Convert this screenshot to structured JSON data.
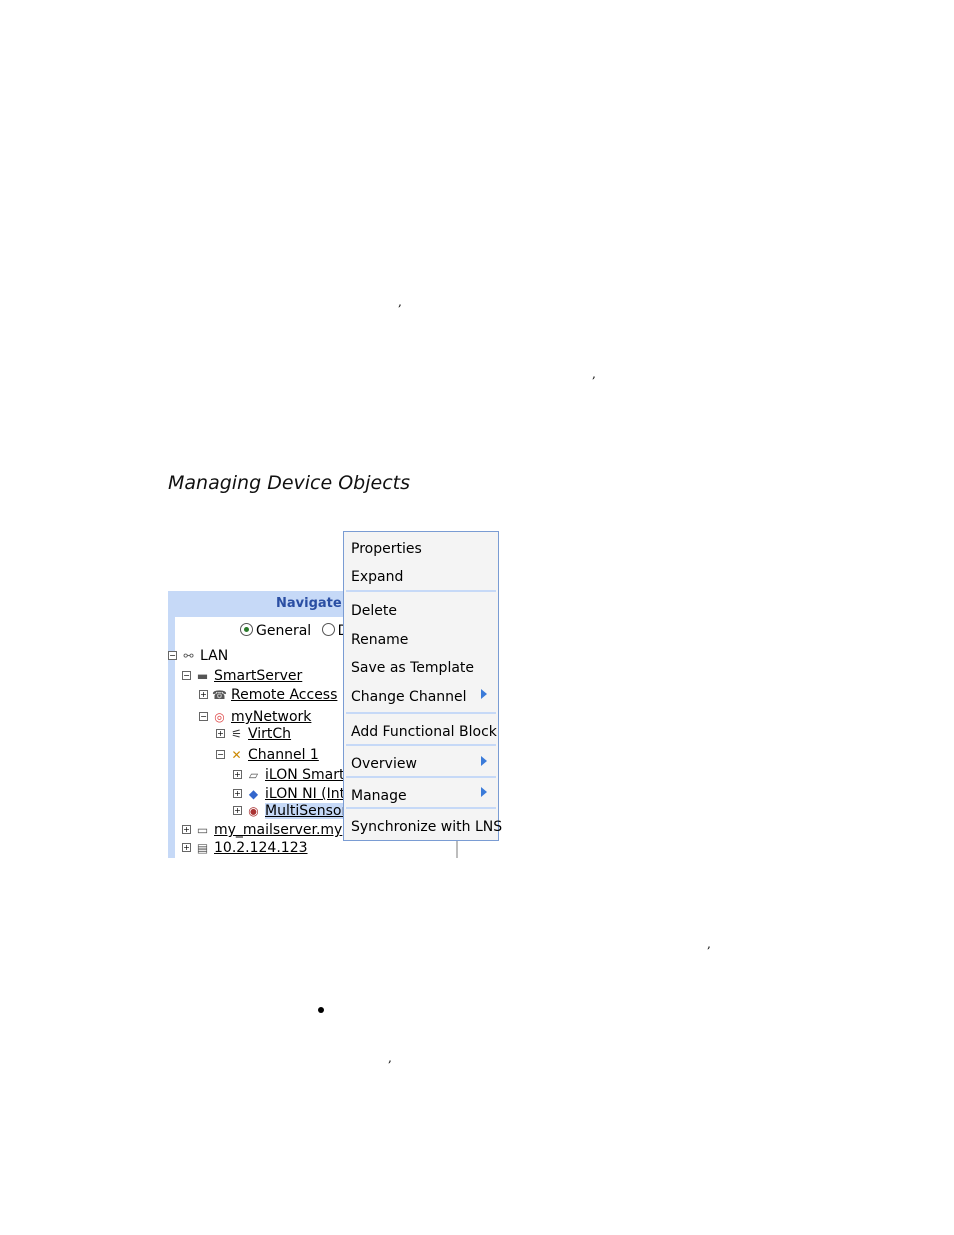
{
  "document": {
    "marks": [
      ",",
      ",",
      ",",
      ","
    ],
    "heading": "Managing Device Objects"
  },
  "tree_panel": {
    "title": "Navigate",
    "radios": [
      {
        "label": "General",
        "selected": true
      },
      {
        "label": "D",
        "selected": false
      }
    ],
    "nodes": [
      {
        "label": "LAN",
        "toggle": "−",
        "icon": "lan-icon"
      },
      {
        "label": "SmartServer",
        "toggle": "−",
        "icon": "server-icon"
      },
      {
        "label": "Remote Access",
        "toggle": "+",
        "icon": "phone-icon"
      },
      {
        "label": "myNetwork",
        "toggle": "−",
        "icon": "network-icon"
      },
      {
        "label": "VirtCh",
        "toggle": "+",
        "icon": "virtual-channel-icon"
      },
      {
        "label": "Channel 1",
        "toggle": "−",
        "icon": "channel-icon"
      },
      {
        "label": "iLON Smart",
        "toggle": "+",
        "icon": "ilon-device-icon"
      },
      {
        "label": "iLON NI (Int",
        "toggle": "+",
        "icon": "network-interface-icon"
      },
      {
        "label": "MultiSensor",
        "toggle": "+",
        "icon": "sensor-icon"
      },
      {
        "label": "my_mailserver.my",
        "toggle": "+",
        "icon": "computer-icon"
      },
      {
        "label": "10.2.124.123",
        "toggle": "+",
        "icon": "server-icon"
      }
    ]
  },
  "context_menu": {
    "items": [
      {
        "label": "Properties",
        "submenu": false
      },
      {
        "label": "Expand",
        "submenu": false
      },
      {
        "label": "Delete",
        "submenu": false
      },
      {
        "label": "Rename",
        "submenu": false
      },
      {
        "label": "Save as Template",
        "submenu": false
      },
      {
        "label": "Change Channel",
        "submenu": true
      },
      {
        "label": "Add Functional Block",
        "submenu": false
      },
      {
        "label": "Overview",
        "submenu": true
      },
      {
        "label": "Manage",
        "submenu": true
      },
      {
        "label": "Synchronize with LNS",
        "submenu": false
      }
    ]
  },
  "colors": {
    "panel_header": "#c6d9f7",
    "title_text": "#2a4ea3",
    "menu_border": "#7a9cd3",
    "submenu_arrow": "#3b7bd9"
  }
}
